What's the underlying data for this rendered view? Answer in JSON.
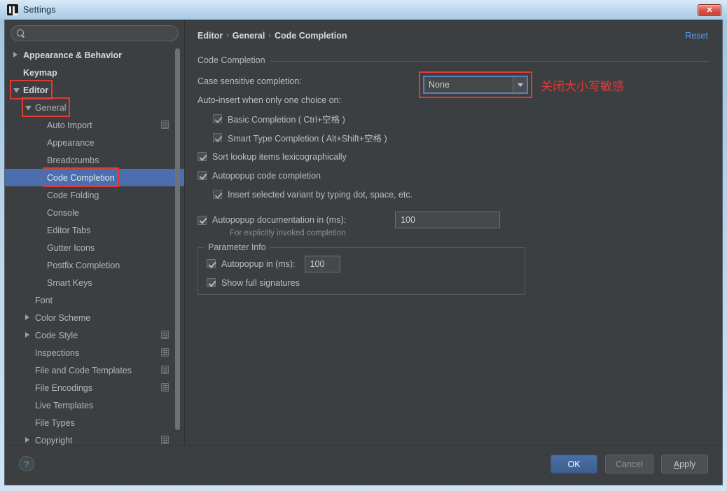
{
  "window": {
    "title": "Settings",
    "icon": "intellij-idea-icon",
    "close_label": "✕"
  },
  "sidebar": {
    "search": {
      "value": "",
      "placeholder": "",
      "icon": "search-icon"
    },
    "items": [
      {
        "label": "Appearance & Behavior",
        "arrow": "right",
        "indent": 0,
        "bold": true,
        "selected": false,
        "scope_icon": false
      },
      {
        "label": "Keymap",
        "arrow": "none",
        "indent": 0,
        "bold": true,
        "selected": false,
        "scope_icon": false
      },
      {
        "label": "Editor",
        "arrow": "down",
        "indent": 0,
        "bold": true,
        "selected": false,
        "scope_icon": false
      },
      {
        "label": "General",
        "arrow": "down",
        "indent": 1,
        "bold": false,
        "selected": false,
        "scope_icon": false
      },
      {
        "label": "Auto Import",
        "arrow": "none",
        "indent": 2,
        "bold": false,
        "selected": false,
        "scope_icon": true
      },
      {
        "label": "Appearance",
        "arrow": "none",
        "indent": 2,
        "bold": false,
        "selected": false,
        "scope_icon": false
      },
      {
        "label": "Breadcrumbs",
        "arrow": "none",
        "indent": 2,
        "bold": false,
        "selected": false,
        "scope_icon": false
      },
      {
        "label": "Code Completion",
        "arrow": "none",
        "indent": 2,
        "bold": false,
        "selected": true,
        "scope_icon": false
      },
      {
        "label": "Code Folding",
        "arrow": "none",
        "indent": 2,
        "bold": false,
        "selected": false,
        "scope_icon": false
      },
      {
        "label": "Console",
        "arrow": "none",
        "indent": 2,
        "bold": false,
        "selected": false,
        "scope_icon": false
      },
      {
        "label": "Editor Tabs",
        "arrow": "none",
        "indent": 2,
        "bold": false,
        "selected": false,
        "scope_icon": false
      },
      {
        "label": "Gutter Icons",
        "arrow": "none",
        "indent": 2,
        "bold": false,
        "selected": false,
        "scope_icon": false
      },
      {
        "label": "Postfix Completion",
        "arrow": "none",
        "indent": 2,
        "bold": false,
        "selected": false,
        "scope_icon": false
      },
      {
        "label": "Smart Keys",
        "arrow": "none",
        "indent": 2,
        "bold": false,
        "selected": false,
        "scope_icon": false
      },
      {
        "label": "Font",
        "arrow": "none",
        "indent": 1,
        "bold": false,
        "selected": false,
        "scope_icon": false
      },
      {
        "label": "Color Scheme",
        "arrow": "right",
        "indent": 1,
        "bold": false,
        "selected": false,
        "scope_icon": false
      },
      {
        "label": "Code Style",
        "arrow": "right",
        "indent": 1,
        "bold": false,
        "selected": false,
        "scope_icon": true
      },
      {
        "label": "Inspections",
        "arrow": "none",
        "indent": 1,
        "bold": false,
        "selected": false,
        "scope_icon": true
      },
      {
        "label": "File and Code Templates",
        "arrow": "none",
        "indent": 1,
        "bold": false,
        "selected": false,
        "scope_icon": true
      },
      {
        "label": "File Encodings",
        "arrow": "none",
        "indent": 1,
        "bold": false,
        "selected": false,
        "scope_icon": true
      },
      {
        "label": "Live Templates",
        "arrow": "none",
        "indent": 1,
        "bold": false,
        "selected": false,
        "scope_icon": false
      },
      {
        "label": "File Types",
        "arrow": "none",
        "indent": 1,
        "bold": false,
        "selected": false,
        "scope_icon": false
      },
      {
        "label": "Copyright",
        "arrow": "right",
        "indent": 1,
        "bold": false,
        "selected": false,
        "scope_icon": true
      }
    ]
  },
  "main": {
    "breadcrumb": {
      "part1": "Editor",
      "part2": "General",
      "part3": "Code Completion",
      "sep": "›"
    },
    "reset_label": "Reset",
    "group_title": "Code Completion",
    "case_sensitive": {
      "label": "Case sensitive completion:",
      "value": "None"
    },
    "annotation": "关闭大小写敏感",
    "auto_insert_label": "Auto-insert when only one choice on:",
    "checkboxes": {
      "basic_completion": {
        "label": "Basic Completion ( Ctrl+空格 )",
        "checked": true
      },
      "smart_type_completion": {
        "label": "Smart Type Completion ( Alt+Shift+空格 )",
        "checked": true
      },
      "sort_lookup": {
        "label": "Sort lookup items lexicographically",
        "checked": true
      },
      "autopopup_code": {
        "label": "Autopopup code completion",
        "checked": true
      },
      "insert_selected_variant": {
        "label": "Insert selected variant by typing dot, space, etc.",
        "checked": true
      },
      "autopopup_doc": {
        "label": "Autopopup documentation in (ms):",
        "checked": true,
        "value": "100"
      }
    },
    "hint": "For explicitly invoked completion",
    "parameter_info": {
      "title": "Parameter Info",
      "autopopup": {
        "label": "Autopopup in (ms):",
        "checked": true,
        "value": "100"
      },
      "show_signatures": {
        "label": "Show full signatures",
        "checked": true
      }
    }
  },
  "footer": {
    "help_label": "?",
    "ok_label": "OK",
    "cancel_label": "Cancel",
    "apply_label_pre": "A",
    "apply_label_post": "pply"
  },
  "colors": {
    "accent_blue": "#4b6eaf",
    "link_blue": "#589df6",
    "annotation_red": "#e03a33",
    "panel_bg": "#3c3f41"
  }
}
